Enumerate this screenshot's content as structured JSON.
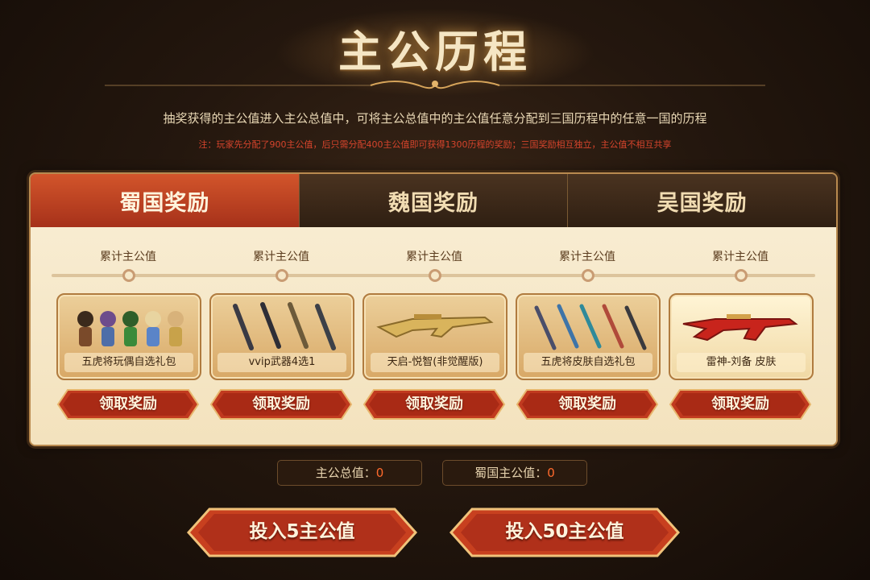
{
  "header": {
    "title": "主公历程",
    "description": "抽奖获得的主公值进入主公总值中，可将主公总值中的主公值任意分配到三国历程中的任意一国的历程",
    "note": "注：玩家先分配了900主公值，后只需分配400主公值即可获得1300历程的奖励；三国奖励相互独立，主公值不相互共享"
  },
  "tabs": [
    {
      "label": "蜀国奖励",
      "active": true
    },
    {
      "label": "魏国奖励",
      "active": false
    },
    {
      "label": "吴国奖励",
      "active": false
    }
  ],
  "rewards": [
    {
      "threshold_label": "累计主公值",
      "name": "五虎将玩偶自选礼包",
      "icon": "hero-figures-icon",
      "button": "领取奖励"
    },
    {
      "threshold_label": "累计主公值",
      "name": "vvip武器4选1",
      "icon": "rifles-icon",
      "button": "领取奖励"
    },
    {
      "threshold_label": "累计主公值",
      "name": "天启-悦智(非觉醒版)",
      "icon": "golden-rifle-icon",
      "button": "领取奖励"
    },
    {
      "threshold_label": "累计主公值",
      "name": "五虎将皮肤自选礼包",
      "icon": "skin-rifles-icon",
      "button": "领取奖励"
    },
    {
      "threshold_label": "累计主公值",
      "name": "雷神-刘备 皮肤",
      "icon": "red-rifle-icon",
      "button": "领取奖励"
    }
  ],
  "stats": {
    "total_label": "主公总值：",
    "total_value": "0",
    "shu_label": "蜀国主公值：",
    "shu_value": "0"
  },
  "actions": {
    "invest5": "投入5主公值",
    "invest50": "投入50主公值"
  },
  "colors": {
    "accent_red": "#c43d20",
    "panel_bg": "#f6e8c8",
    "gold": "#b98a4f",
    "value_orange": "#ff6a2c"
  }
}
